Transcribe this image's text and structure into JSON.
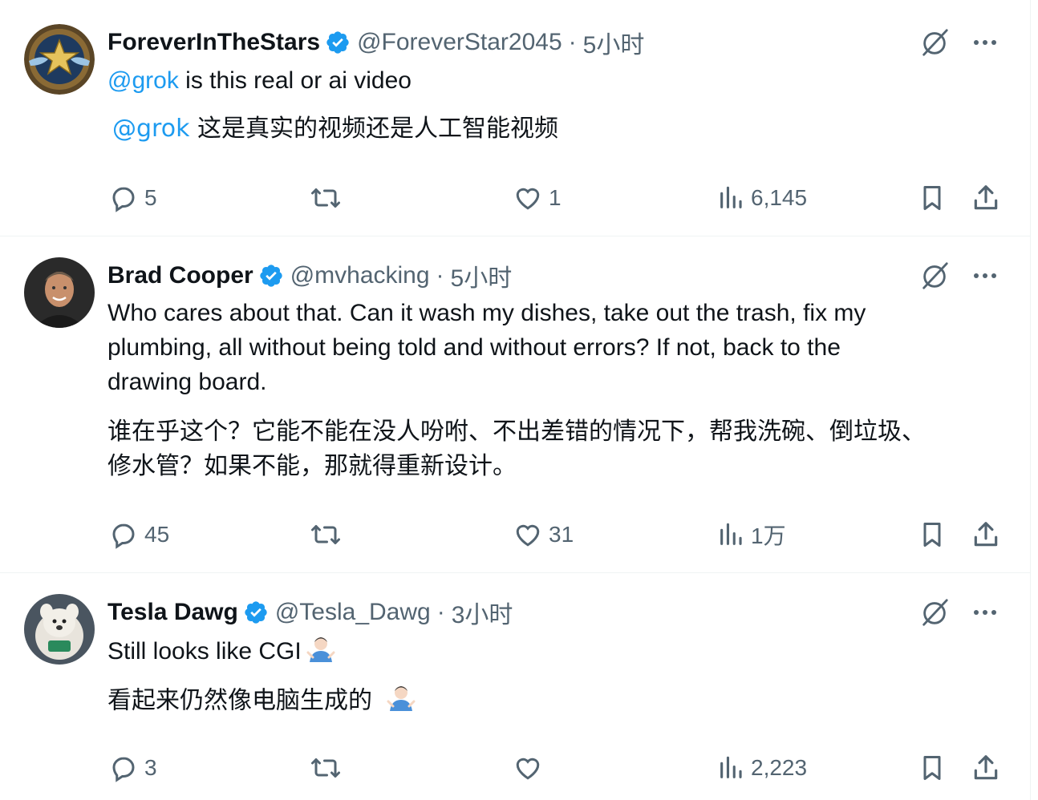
{
  "replies": [
    {
      "display_name": "ForeverInTheStars",
      "handle": "@ForeverStar2045",
      "time": "5小时",
      "body": [
        {
          "mention": "@grok",
          "text": " is this real or ai video"
        },
        {
          "mention": "@grok",
          "text": " 这是真实的视频还是人工智能视频"
        }
      ],
      "counts": {
        "replies": "5",
        "reposts": "",
        "likes": "1",
        "views": "6,145"
      }
    },
    {
      "display_name": "Brad Cooper",
      "handle": "@mvhacking",
      "time": "5小时",
      "body": [
        {
          "line": "Who cares about that. Can it wash my dishes, take out the trash, fix my"
        },
        {
          "line": "plumbing, all without being told and without errors?  If not, back to the"
        },
        {
          "line": "drawing board."
        },
        {
          "line": "谁在乎这个？它能不能在没人吩咐、不出差错的情况下，帮我洗碗、倒垃圾、"
        },
        {
          "line": "修水管？如果不能，那就得重新设计。"
        }
      ],
      "counts": {
        "replies": "45",
        "reposts": "",
        "likes": "31",
        "views": "1万"
      }
    },
    {
      "display_name": "Tesla Dawg",
      "handle": "@Tesla_Dawg",
      "time": "3小时",
      "body": [
        {
          "line": "Still looks like CGI"
        },
        {
          "line": "看起来仍然像电脑生成的"
        }
      ],
      "counts": {
        "replies": "3",
        "reposts": "",
        "likes": "",
        "views": "2,223"
      }
    }
  ],
  "separator": "·",
  "icons": {
    "reply": "reply-bubble-icon",
    "repost": "repost-icon",
    "like": "heart-icon",
    "views": "views-bar-icon",
    "bookmark": "bookmark-icon",
    "share": "share-icon",
    "grok": "grok-slash-icon",
    "more": "more-dots-icon",
    "verified": "verified-badge-icon",
    "emoji": "person-shrugging-emoji"
  },
  "colors": {
    "accent": "#1d9bf0",
    "secondary": "#536471",
    "text": "#0f1419",
    "divider": "#eff3f4"
  }
}
